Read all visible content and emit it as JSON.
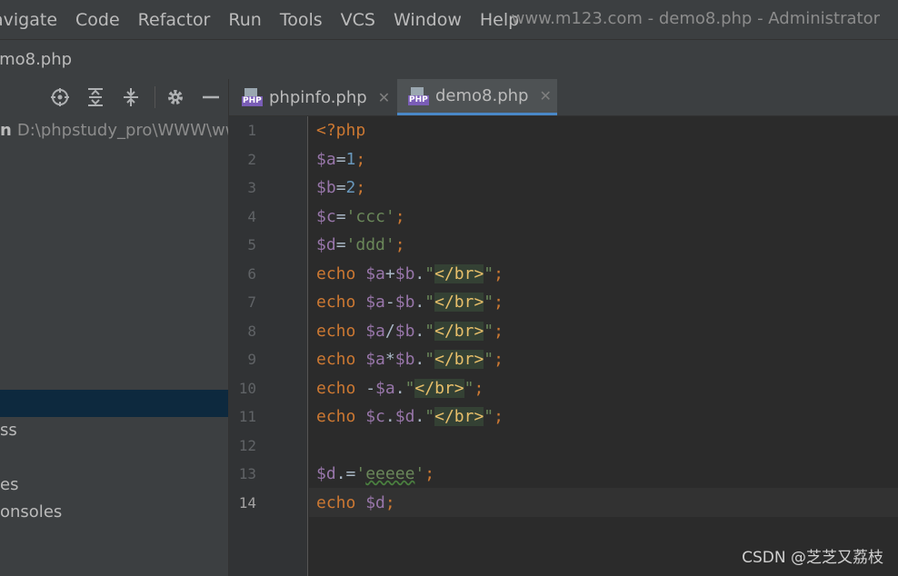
{
  "menu": [
    "avigate",
    "Code",
    "Refactor",
    "Run",
    "Tools",
    "VCS",
    "Window",
    "Help"
  ],
  "window_title": "www.m123.com - demo8.php - Administrator",
  "breadcrumb": "emo8.php",
  "project": {
    "root_suffix": "n",
    "root_path": "D:\\phpstudy_pro\\WWW\\ww",
    "rows": [
      "ss",
      "es",
      "onsoles"
    ]
  },
  "tabs": [
    {
      "label": "phpinfo.php",
      "icon": "php-file-icon",
      "active": false
    },
    {
      "label": "demo8.php",
      "icon": "php-file-icon",
      "active": true
    }
  ],
  "editor": {
    "line_numbers": [
      "1",
      "2",
      "3",
      "4",
      "5",
      "6",
      "7",
      "8",
      "9",
      "10",
      "11",
      "12",
      "13",
      "14"
    ],
    "current_line": "14",
    "lines": [
      "<?php",
      "$a=1;",
      "$b=2;",
      "$c='ccc';",
      "$d='ddd';",
      "echo $a+$b.\"</br>\";",
      "echo $a-$b.\"</br>\";",
      "echo $a/$b.\"</br>\";",
      "echo $a*$b.\"</br>\";",
      "echo -$a.\"</br>\";",
      "echo $c.$d.\"</br>\";",
      "",
      "$d.='eeeee';",
      "echo $d;"
    ]
  },
  "watermark": "CSDN @芝芝又荔枝",
  "colors": {
    "keyword": "#cc7832",
    "variable": "#9876aa",
    "number": "#6897bb",
    "string": "#6a8759",
    "tag": "#e8bf6a",
    "selection": "#0d293e"
  }
}
